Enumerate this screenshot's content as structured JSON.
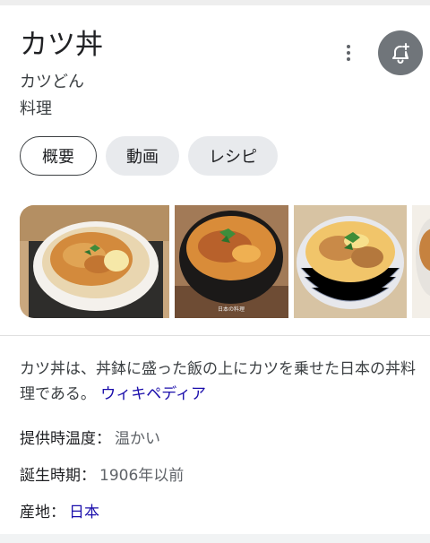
{
  "header": {
    "title": "カツ丼",
    "reading": "カツどん",
    "category": "料理",
    "more_icon": "more-vert-icon",
    "bell_icon": "add-alert-icon",
    "bell_color": "#70757a"
  },
  "tabs": [
    {
      "label": "概要",
      "active": true
    },
    {
      "label": "動画",
      "active": false
    },
    {
      "label": "レシピ",
      "active": false
    }
  ],
  "images": [
    {
      "subject": "katsudon-bowl-white",
      "watermark": ""
    },
    {
      "subject": "katsudon-bowl-black",
      "watermark": "日本の料理"
    },
    {
      "subject": "katsudon-bowl-pattern",
      "watermark": ""
    },
    {
      "subject": "katsudon-bowl-partial",
      "watermark": ""
    }
  ],
  "description": {
    "text": "カツ丼は、丼鉢に盛った飯の上にカツを乗せた日本の丼料理である。",
    "source_link": "ウィキペディア"
  },
  "facts": [
    {
      "label": "提供時温度：",
      "value": "温かい",
      "is_link": false
    },
    {
      "label": "誕生時期：",
      "value": "1906年以前",
      "is_link": false
    },
    {
      "label": "産地：",
      "value": "日本",
      "is_link": true
    }
  ],
  "colors": {
    "link": "#1a0dab",
    "chip_bg": "#e8eaed",
    "text_primary": "#202124",
    "text_secondary": "#5f6368"
  }
}
